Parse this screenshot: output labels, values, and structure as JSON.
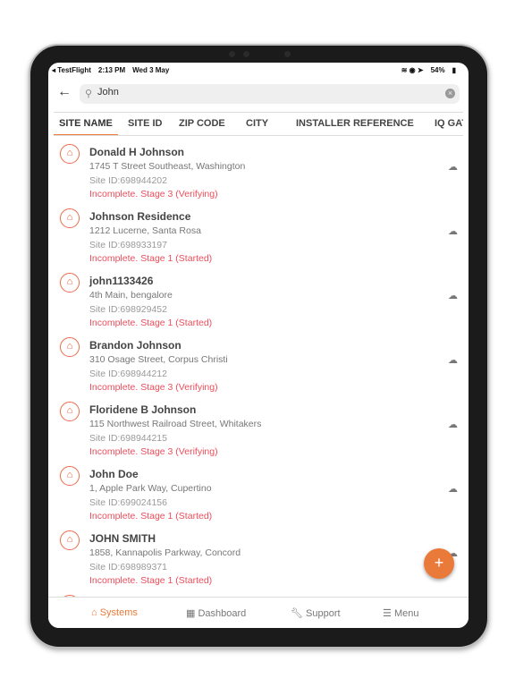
{
  "status_bar": {
    "carrier": "◂ TestFlight",
    "time": "2:13 PM",
    "date": "Wed 3 May",
    "battery": "54%"
  },
  "search": {
    "value": "John"
  },
  "tabs": [
    {
      "label": "SITE NAME",
      "active": true
    },
    {
      "label": "SITE ID"
    },
    {
      "label": "ZIP CODE"
    },
    {
      "label": "CITY"
    },
    {
      "label": "INSTALLER REFERENCE"
    },
    {
      "label": "IQ GAT"
    }
  ],
  "sites": [
    {
      "name": "Donald H Johnson",
      "address": "1745 T Street Southeast, Washington",
      "site_id": "Site ID:698944202",
      "status": "Incomplete. Stage 3 (Verifying)"
    },
    {
      "name": "Johnson Residence",
      "address": "1212 Lucerne, Santa Rosa",
      "site_id": "Site ID:698933197",
      "status": "Incomplete. Stage 1 (Started)"
    },
    {
      "name": "john1133426",
      "address": "4th Main, bengalore",
      "site_id": "Site ID:698929452",
      "status": "Incomplete. Stage 1 (Started)"
    },
    {
      "name": "Brandon Johnson",
      "address": "310 Osage Street, Corpus Christi",
      "site_id": "Site ID:698944212",
      "status": "Incomplete. Stage 3 (Verifying)"
    },
    {
      "name": "Floridene B Johnson",
      "address": "115 Northwest Railroad Street, Whitakers",
      "site_id": "Site ID:698944215",
      "status": "Incomplete. Stage 3 (Verifying)"
    },
    {
      "name": "John Doe",
      "address": "1, Apple Park Way, Cupertino",
      "site_id": "Site ID:699024156",
      "status": "Incomplete. Stage 1 (Started)"
    },
    {
      "name": "JOHN SMITH",
      "address": "1858, Kannapolis Parkway, Concord",
      "site_id": "Site ID:698989371",
      "status": "Incomplete. Stage 1 (Started)"
    }
  ],
  "fab": "+",
  "nav": [
    {
      "label": "Systems",
      "icon": "home-icon",
      "active": true
    },
    {
      "label": "Dashboard",
      "icon": "dashboard-icon"
    },
    {
      "label": "Support",
      "icon": "wrench-icon"
    },
    {
      "label": "Menu",
      "icon": "menu-icon"
    }
  ],
  "colors": {
    "accent": "#ea7a39",
    "status": "#ee4e5c"
  }
}
